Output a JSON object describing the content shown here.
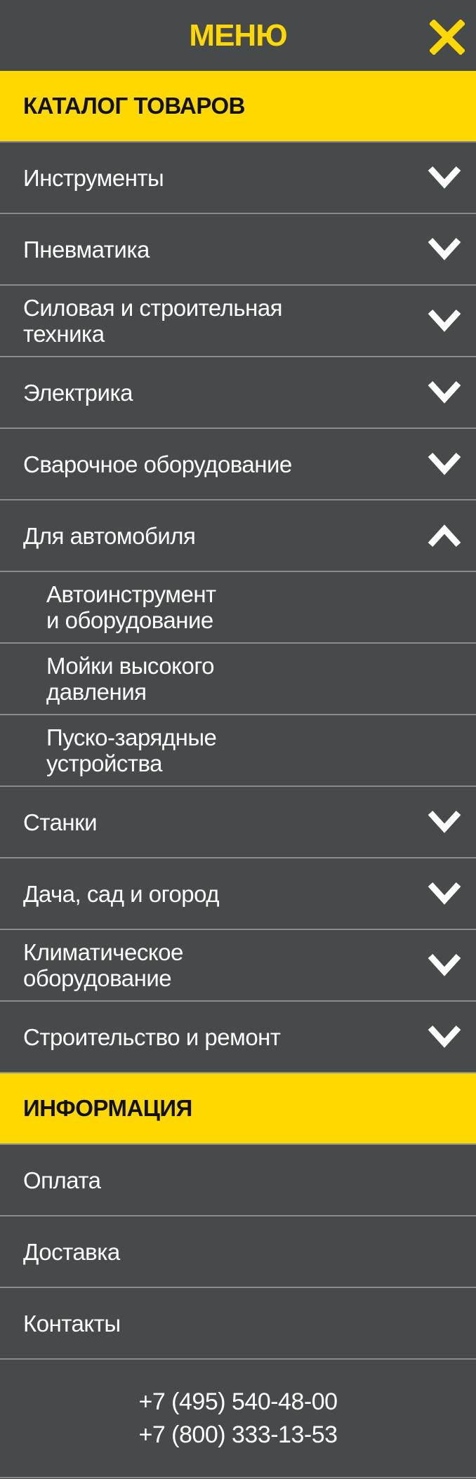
{
  "header": {
    "title": "МЕНЮ",
    "close_icon": "close-icon"
  },
  "colors": {
    "accent": "#ffd800",
    "background": "#464a4b",
    "divider": "#8a8c8c"
  },
  "catalog": {
    "title": "КАТАЛОГ ТОВАРОВ",
    "items": [
      {
        "label": "Инструменты",
        "state": "collapsed"
      },
      {
        "label": "Пневматика",
        "state": "collapsed"
      },
      {
        "label": "Силовая и строительная\nтехника",
        "state": "collapsed"
      },
      {
        "label": "Электрика",
        "state": "collapsed"
      },
      {
        "label": "Сварочное оборудование",
        "state": "collapsed"
      },
      {
        "label": "Для автомобиля",
        "state": "expanded",
        "children": [
          {
            "label": "Автоинструмент\nи оборудование"
          },
          {
            "label": "Мойки высокого\nдавления"
          },
          {
            "label": "Пуско-зарядные\nустройства"
          }
        ]
      },
      {
        "label": "Станки",
        "state": "collapsed"
      },
      {
        "label": "Дача, сад и огород",
        "state": "collapsed"
      },
      {
        "label": "Климатическое\nоборудование",
        "state": "collapsed"
      },
      {
        "label": "Строительство и ремонт",
        "state": "collapsed"
      }
    ]
  },
  "info": {
    "title": "ИНФОРМАЦИЯ",
    "items": [
      {
        "label": "Оплата"
      },
      {
        "label": "Доставка"
      },
      {
        "label": "Контакты"
      }
    ]
  },
  "phones": [
    "+7 (495) 540-48-00",
    "+7 (800) 333-13-53"
  ]
}
